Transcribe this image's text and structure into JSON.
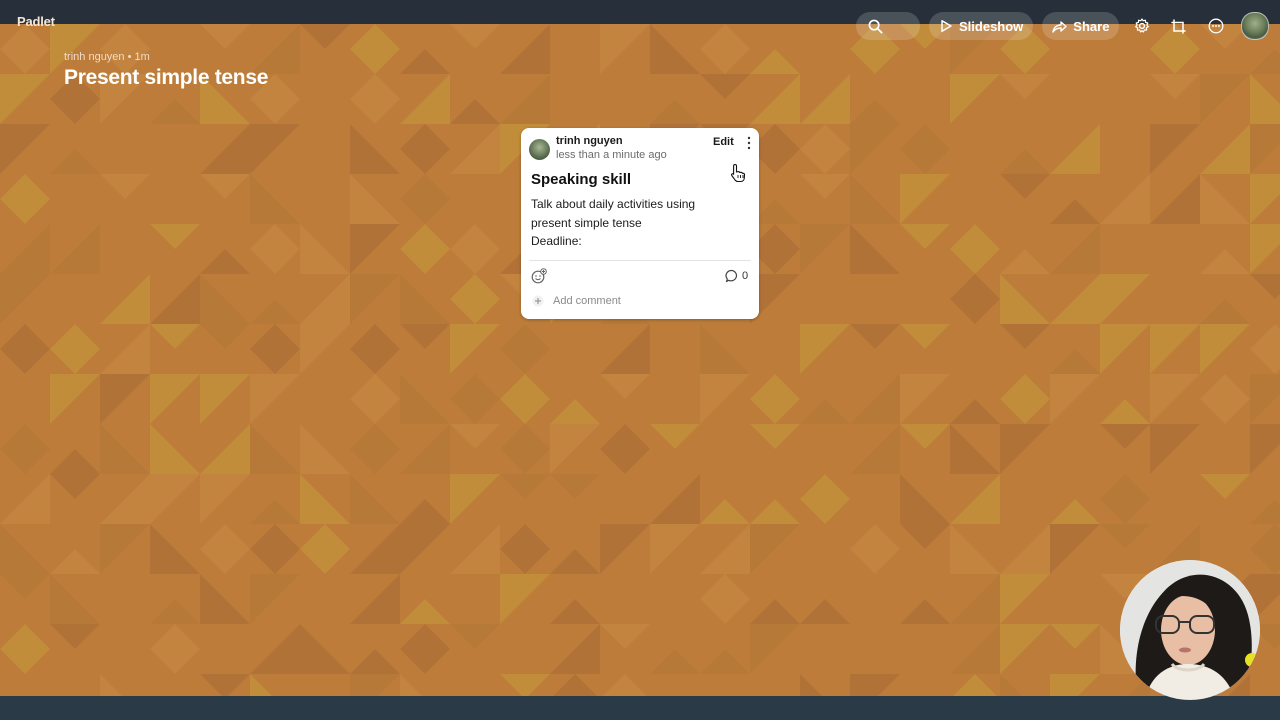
{
  "app": {
    "logo": "Padlet"
  },
  "board": {
    "author": "trinh nguyen",
    "age": "1m",
    "meta": "trinh nguyen • 1m",
    "title": "Present simple tense"
  },
  "toolbar": {
    "search_icon": "search-icon",
    "slideshow_label": "Slideshow",
    "share_label": "Share",
    "icons": [
      "gear-icon",
      "remake-icon",
      "more-icon",
      "avatar"
    ]
  },
  "post": {
    "author": "trinh nguyen",
    "timestamp": "less than a minute ago",
    "edit_label": "Edit",
    "title": "Speaking skill",
    "body_lines": [
      "Talk about daily activities using",
      "present simple tense",
      "Deadline:"
    ],
    "comment_count": "0",
    "add_comment_label": "Add comment"
  },
  "colors": {
    "wall": "#bd7c3a",
    "wall_dark": "#a86a34",
    "wall_gold": "#c69a3a",
    "card": "#ffffff"
  }
}
